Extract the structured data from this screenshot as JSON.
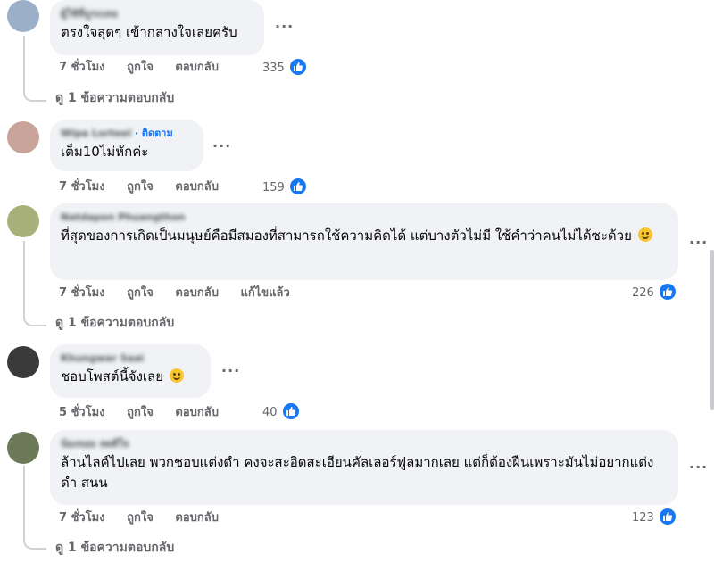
{
  "comments": [
    {
      "author": "ผู้ใช้ที่ถูกเบลอ",
      "follow": "",
      "text": "ตรงใจสุดๆ เข้ากลางใจเลยครับ",
      "time": "7 ชั่วโมง",
      "like_label": "ถูกใจ",
      "reply_label": "ตอบกลับ",
      "edited": "",
      "reaction_count": "335",
      "replies_label": "ดู 1 ข้อความตอบกลับ",
      "avatar_color": "#9bb0c8"
    },
    {
      "author": "Wipa Lorteel",
      "follow": "· ติดตาม",
      "text": "เต็ม10ไม่หักค่ะ",
      "time": "7 ชั่วโมง",
      "like_label": "ถูกใจ",
      "reply_label": "ตอบกลับ",
      "edited": "",
      "reaction_count": "159",
      "replies_label": "",
      "avatar_color": "#c9a49a"
    },
    {
      "author": "Natdapon Phuangthon",
      "follow": "",
      "text": "ที่สุดของการเกิดเป็นมนุษย์คือมีสมองที่สามารถใช้ความคิดได้ แต่บางตัวไม่มี ใช้คำว่าคนไม่ได้ซะด้วย",
      "time": "7 ชั่วโมง",
      "like_label": "ถูกใจ",
      "reply_label": "ตอบกลับ",
      "edited": "แก้ไขแล้ว",
      "reaction_count": "226",
      "replies_label": "ดู 1 ข้อความตอบกลับ",
      "avatar_color": "#a8b07a"
    },
    {
      "author": "Khungwar Saai",
      "follow": "",
      "text": "ชอบโพสต์นี้จังเลย",
      "time": "5 ชั่วโมง",
      "like_label": "ถูกใจ",
      "reply_label": "ตอบกลับ",
      "edited": "",
      "reaction_count": "40",
      "replies_label": "",
      "avatar_color": "#3a3a3a"
    },
    {
      "author": "น้องจอม ลดดีใจ",
      "follow": "",
      "text": "ล้านไลค์ไปเลย พวกชอบแต่งดำ คงจะสะอิดสะเอียนคัลเลอร์ฟูลมากเลย แต่ก็ต้องฝืนเพราะมันไม่อยากแต่งดำ สนน",
      "time": "7 ชั่วโมง",
      "like_label": "ถูกใจ",
      "reply_label": "ตอบกลับ",
      "edited": "",
      "reaction_count": "123",
      "replies_label": "ดู 1 ข้อความตอบกลับ",
      "avatar_color": "#6d7a5a"
    }
  ],
  "icons": {
    "like": "thumbs-up-icon",
    "more": "more-options-icon",
    "emoji": "smiling-face-icon"
  },
  "colors": {
    "bubble": "#f0f2f5",
    "accent": "#1877f2",
    "meta": "#65676b"
  },
  "more_glyph": "···"
}
